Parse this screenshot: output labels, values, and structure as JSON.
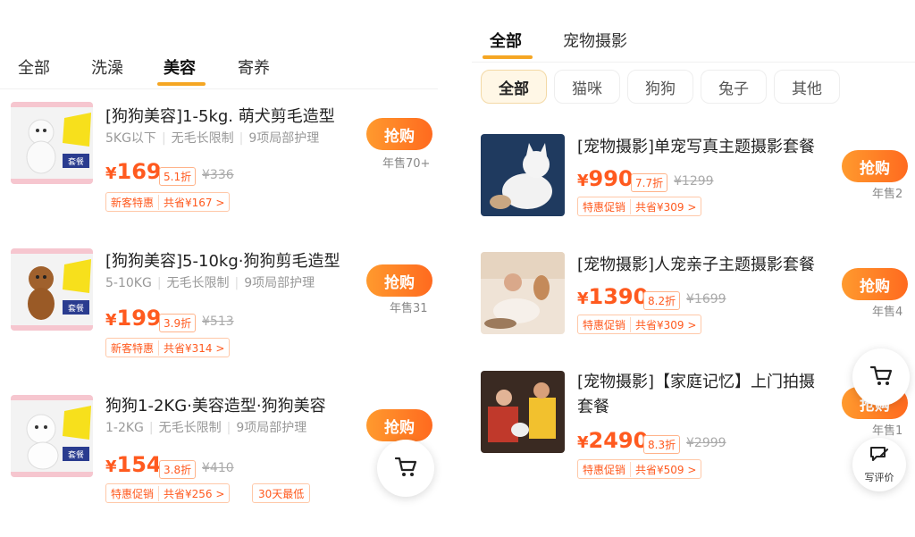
{
  "left": {
    "tabs": [
      "全部",
      "洗澡",
      "美容",
      "寄养"
    ],
    "active_tab": "美容",
    "products": [
      {
        "title": "[狗狗美容]1-5kg. 萌犬剪毛造型",
        "tags": [
          "5KG以下",
          "无毛长限制",
          "9项局部护理"
        ],
        "yen": "¥",
        "price": "169",
        "discount": "5.1折",
        "orig": "¥336",
        "promo": "新客特惠",
        "save": "共省¥167 >",
        "buy": "抢购",
        "sold": "年售70+"
      },
      {
        "title": "[狗狗美容]5-10kg·狗狗剪毛造型",
        "tags": [
          "5-10KG",
          "无毛长限制",
          "9项局部护理"
        ],
        "yen": "¥",
        "price": "199",
        "discount": "3.9折",
        "orig": "¥513",
        "promo": "新客特惠",
        "save": "共省¥314 >",
        "buy": "抢购",
        "sold": "年售31"
      },
      {
        "title": "狗狗1-2KG·美容造型·狗狗美容",
        "tags": [
          "1-2KG",
          "无毛长限制",
          "9项局部护理"
        ],
        "yen": "¥",
        "price": "154",
        "discount": "3.8折",
        "orig": "¥410",
        "promo": "特惠促销",
        "save": "共省¥256 >",
        "extra": "30天最低",
        "buy": "抢购",
        "sold": ""
      }
    ]
  },
  "right": {
    "tabs": [
      "全部",
      "宠物摄影"
    ],
    "active_tab": "全部",
    "chips": [
      "全部",
      "猫咪",
      "狗狗",
      "兔子",
      "其他"
    ],
    "active_chip": "全部",
    "products": [
      {
        "title": "[宠物摄影]单宠写真主题摄影套餐",
        "yen": "¥",
        "price": "990",
        "discount": "7.7折",
        "orig": "¥1299",
        "promo": "特惠促销",
        "save": "共省¥309 >",
        "buy": "抢购",
        "sold": "年售2"
      },
      {
        "title": "[宠物摄影]人宠亲子主题摄影套餐",
        "yen": "¥",
        "price": "1390",
        "discount": "8.2折",
        "orig": "¥1699",
        "promo": "特惠促销",
        "save": "共省¥309 >",
        "buy": "抢购",
        "sold": "年售4"
      },
      {
        "title_line1": "[宠物摄影]【家庭记忆】上门拍摄",
        "title_line2": "套餐",
        "yen": "¥",
        "price": "2490",
        "discount": "8.3折",
        "orig": "¥2999",
        "promo": "特惠促销",
        "save": "共省¥509 >",
        "buy": "抢购",
        "sold": "年售1"
      }
    ],
    "review_label": "写评价"
  },
  "colors": {
    "accent": "#ff5a1f",
    "tab_underline": "#f5a623",
    "chip_active_bg": "#fff7e6"
  },
  "icons": [
    "cart-icon",
    "review-icon"
  ]
}
